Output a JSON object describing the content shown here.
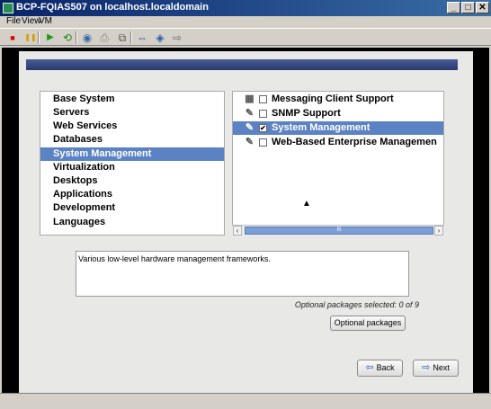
{
  "window": {
    "title": "BCP-FQIAS507 on localhost.localdomain",
    "controls": {
      "minimize": "_",
      "maximize": "□",
      "close": "✕"
    }
  },
  "menu": [
    "File",
    "View",
    "VM"
  ],
  "toolbar": {
    "icons": [
      "power-off-icon",
      "pause-icon",
      "play-icon",
      "reset-icon",
      "snapshot-icon",
      "revert-icon",
      "manage-snapshots-icon",
      "fullscreen-icon",
      "quick-switch-icon",
      "unity-icon"
    ],
    "glyphs": [
      "■",
      "❚❚",
      "▶",
      "⟲",
      "◉",
      "⎙",
      "⧉",
      "⇔",
      "◈",
      "⇨"
    ]
  },
  "installer": {
    "groups": [
      {
        "label": "Base System",
        "selected": false
      },
      {
        "label": "Servers",
        "selected": false
      },
      {
        "label": "Web Services",
        "selected": false
      },
      {
        "label": "Databases",
        "selected": false
      },
      {
        "label": "System Management",
        "selected": true
      },
      {
        "label": "Virtualization",
        "selected": false
      },
      {
        "label": "Desktops",
        "selected": false
      },
      {
        "label": "Applications",
        "selected": false
      },
      {
        "label": "Development",
        "selected": false
      },
      {
        "label": "Languages",
        "selected": false
      }
    ],
    "packages": [
      {
        "label": "Messaging Client Support",
        "checked": false,
        "selected": false,
        "icon": "package-group-icon"
      },
      {
        "label": "SNMP Support",
        "checked": false,
        "selected": false,
        "icon": "package-icon"
      },
      {
        "label": "System Management",
        "checked": true,
        "selected": true,
        "icon": "package-icon"
      },
      {
        "label": "Web-Based Enterprise Managemen",
        "checked": false,
        "selected": false,
        "icon": "package-icon"
      }
    ],
    "scroll": {
      "left": "‹",
      "right": "›",
      "grip": "III"
    },
    "description": "Various low-level hardware management frameworks.",
    "optional_status": "Optional packages selected: 0 of 9",
    "optional_button": "Optional packages",
    "back_button": "Back",
    "next_button": "Next",
    "back_arrow": "⇦",
    "next_arrow": "⇨"
  },
  "colors": {
    "selection": "#5b82c2",
    "banner": "#3a4a80",
    "titlebar": "#0a246a"
  }
}
